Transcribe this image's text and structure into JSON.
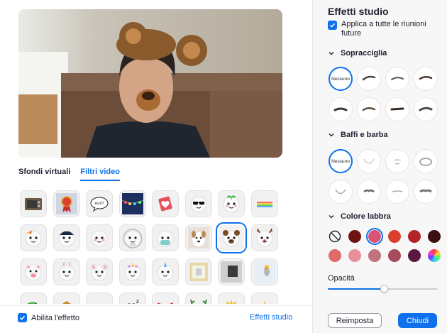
{
  "video": {
    "pip_icon": "picture-in-picture-icon"
  },
  "tabs": [
    {
      "label": "Sfondi virtuali",
      "active": false
    },
    {
      "label": "Filtri video",
      "active": true
    }
  ],
  "filters": [
    "tv-frame-icon",
    "award-ribbon-icon",
    "speech-bubble-icon",
    "string-lights-icon",
    "heart-sticker-icon",
    "sunglasses-face-icon",
    "sprout-face-icon",
    "rainbow-icon",
    "pizza-face-icon",
    "cap-face-icon",
    "blush-face-icon",
    "astronaut-face-icon",
    "mask-face-icon",
    "dog-face-icon",
    "bear-face-icon",
    "reindeer-face-icon",
    "pig-face-icon",
    "bunny-face-icon",
    "mouse-face-icon",
    "unicorn-face-icon",
    "unicorn-horn-face-icon",
    "photo-frame-icon",
    "dark-frame-icon",
    "parrot-icon",
    "leaf-icon",
    "hat-icon",
    "chef-hat-icon",
    "sleep-zzz-icon",
    "bow-tie-icon",
    "antlers-icon",
    "crown-icon",
    "sparkle-icon"
  ],
  "selected_filter_index": 14,
  "speech_bubble_text": "Huh?",
  "footer": {
    "enable_label": "Abilita l'effetto",
    "enable_checked": true,
    "studio_link": "Effetti studio"
  },
  "studio": {
    "title": "Effetti studio",
    "apply_all_label": "Applica a tutte le riunioni future",
    "apply_all_checked": true,
    "eyebrows": {
      "heading": "Sopracciglia",
      "none_label": "Nessuno",
      "selected_index": 0,
      "count": 8
    },
    "beard": {
      "heading": "Baffi e barba",
      "none_label": "Nessuno",
      "selected_index": 0,
      "count": 8
    },
    "lips": {
      "heading": "Colore labbra",
      "selected_index": 2,
      "colors": [
        "none",
        "#6e1414",
        "#d65577",
        "#d9402b",
        "#b3242a",
        "#3a1010",
        "#e06a6a",
        "#e8909a",
        "#c0737d",
        "#a64a5e",
        "#5a1740",
        "rainbow"
      ]
    },
    "opacity": {
      "label": "Opacità",
      "value": 0.51
    },
    "reset_button": "Reimposta",
    "close_button": "Chiudi"
  },
  "accent_color": "#0e71eb"
}
